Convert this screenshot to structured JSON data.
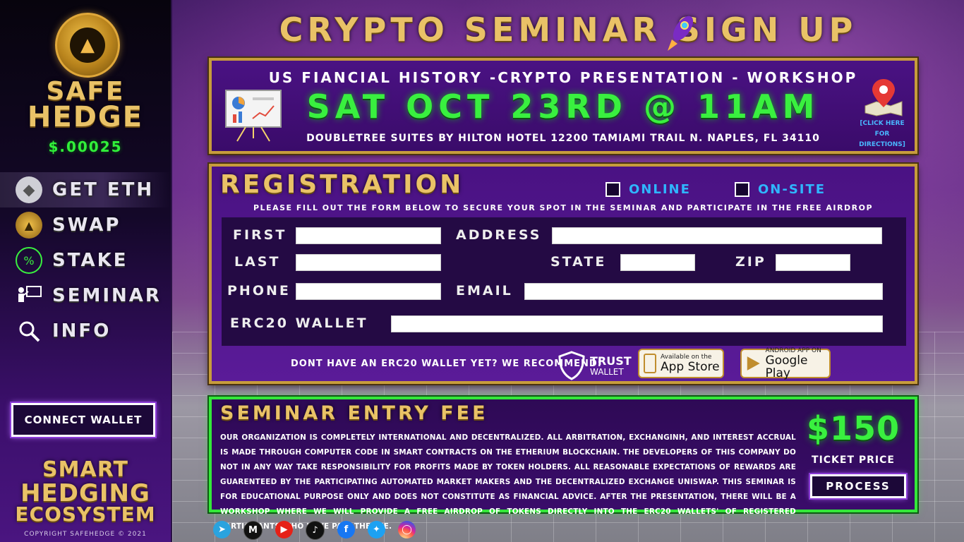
{
  "sidebar": {
    "brand_line1": "SAFE",
    "brand_line2": "HEDGE",
    "price": "$.00025",
    "nav": [
      {
        "label": "GET ETH",
        "icon": "ethereum-icon"
      },
      {
        "label": "SWAP",
        "icon": "safehedge-coin-icon"
      },
      {
        "label": "STAKE",
        "icon": "stake-percent-icon"
      },
      {
        "label": "SEMINAR",
        "icon": "presentation-icon"
      },
      {
        "label": "INFO",
        "icon": "magnifier-icon"
      }
    ],
    "connect_wallet": "CONNECT WALLET",
    "tagline1": "SMART",
    "tagline2": "HEDGING",
    "tagline3": "ECOSYSTEM",
    "copyright": "COPYRIGHT SAFEHEDGE © 2021"
  },
  "page_title": "CRYPTO SEMINAR SIGN UP",
  "event": {
    "subtitle": "US FIANCIAL HISTORY -CRYPTO PRESENTATION - WORKSHOP",
    "date": "SAT OCT 23RD @ 11AM",
    "address": "DOUBLETREE SUITES BY HILTON HOTEL 12200 TAMIAMI TRAIL N. NAPLES, FL 34110",
    "directions_line1": "[CLICK HERE",
    "directions_line2": "FOR DIRECTIONS]"
  },
  "registration": {
    "title": "REGISTRATION",
    "online_label": "ONLINE",
    "onsite_label": "ON-SITE",
    "instructions": "PLEASE FILL OUT THE FORM BELOW TO SECURE YOUR SPOT IN THE SEMINAR AND PARTICIPATE IN THE FREE AIRDROP",
    "fields": {
      "first": "FIRST",
      "last": "LAST",
      "phone": "PHONE",
      "address": "ADDRESS",
      "state": "STATE",
      "zip": "ZIP",
      "email": "EMAIL",
      "wallet": "ERC20 WALLET"
    },
    "recommend_text": "DONT HAVE AN ERC20 WALLET YET? WE RECOMMEND:",
    "trust_line1": "TRUST",
    "trust_line2": "WALLET",
    "appstore_small": "Available on the",
    "appstore_large": "App Store",
    "googleplay_small": "ANDROID APP ON",
    "googleplay_large": "Google Play"
  },
  "fee": {
    "title": "SEMINAR ENTRY FEE",
    "body": "OUR ORGANIZATION IS COMPLETELY INTERNATIONAL AND DECENTRALIZED. ALL ARBITRATION, EXCHANGINH, AND INTEREST ACCRUAL IS MADE THROUGH COMPUTER CODE IN SMART CONTRACTS ON THE ETHERIUM BLOCKCHAIN. THE DEVELOPERS OF THIS COMPANY DO NOT IN ANY WAY TAKE RESPONSIBILITY FOR PROFITS MADE BY TOKEN HOLDERS. ALL REASONABLE EXPECTATIONS OF REWARDS ARE GUARENTEED BY THE PARTICIPATING AUTOMATED MARKET MAKERS AND THE DECENTRALIZED EXCHANGE UNISWAP. THIS SEMINAR IS FOR EDUCATIONAL PURPOSE ONLY AND DOES NOT CONSTITUTE AS FINANCIAL ADVICE. AFTER THE PRESENTATION, THERE WILL BE A WORKSHOP WHERE WE WILL PROVIDE A FREE AIRDROP OF TOKENS DIRECTLY INTO THE ERC20 WALLETS' OF REGISTERED PARTICIPANTS WHO HAVE PAID THE FEE.",
    "price": "$150",
    "ticket_label": "TICKET PRICE",
    "process": "PROCESS"
  },
  "socials": [
    {
      "icon": "telegram-icon",
      "color": "#2aa3df"
    },
    {
      "icon": "medium-icon",
      "color": "#111111"
    },
    {
      "icon": "youtube-icon",
      "color": "#e62117"
    },
    {
      "icon": "tiktok-icon",
      "color": "#111111"
    },
    {
      "icon": "facebook-icon",
      "color": "#1877f2"
    },
    {
      "icon": "twitter-icon",
      "color": "#1da1f2"
    },
    {
      "icon": "instagram-icon",
      "color": "#d62976"
    }
  ],
  "colors": {
    "gold": "#e9c267",
    "neon_green": "#39f03f",
    "accent_blue": "#2fb6ff",
    "panel_purple": "#3d0c6e"
  }
}
